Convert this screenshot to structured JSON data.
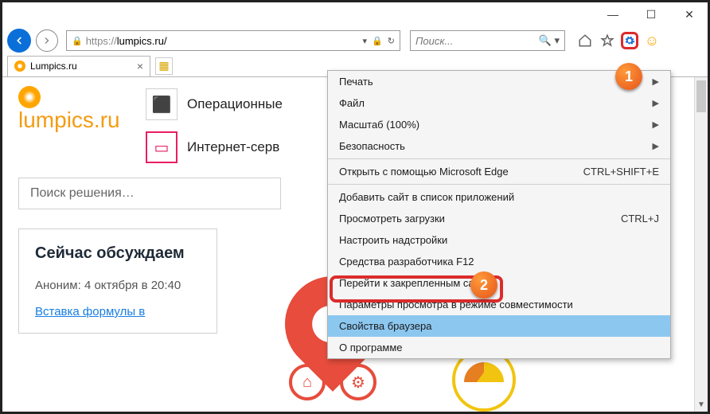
{
  "window": {
    "min": "—",
    "max": "☐",
    "close": "✕"
  },
  "toolbar": {
    "url_proto": "https://",
    "url_domain": "lumpics.ru/",
    "refresh": "↻",
    "search_placeholder": "Поиск...",
    "search_dropdown": "▾"
  },
  "tab": {
    "title": "Lumpics.ru"
  },
  "page": {
    "logo_text": "lumpics.ru",
    "link1": "Операционные",
    "link2": "Интернет-серв",
    "search_placeholder": "Поиск решения…",
    "discuss_heading": "Сейчас обсуждаем",
    "discuss_meta": "Аноним: 4 октября в 20:40",
    "discuss_link": "Вставка формулы в"
  },
  "menu": {
    "print": "Печать",
    "file": "Файл",
    "zoom": "Масштаб (100%)",
    "safety": "Безопасность",
    "edge": "Открыть с помощью Microsoft Edge",
    "edge_short": "CTRL+SHIFT+E",
    "addsite": "Добавить сайт в список приложений",
    "downloads": "Просмотреть загрузки",
    "downloads_short": "CTRL+J",
    "addons": "Настроить надстройки",
    "devtools": "Средства разработчика F12",
    "pinned": "Перейти к закрепленным сайтам",
    "compat": "Параметры просмотра в режиме совместимости",
    "options": "Свойства браузера",
    "about": "О программе"
  },
  "badges": {
    "one": "1",
    "two": "2"
  }
}
